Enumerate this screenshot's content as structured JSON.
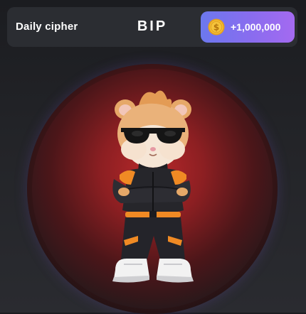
{
  "cipher": {
    "label": "Daily cipher",
    "word": "BIP",
    "reward": "+1,000,000"
  },
  "icons": {
    "coin": "coin-icon",
    "character": "hamster-character-icon"
  },
  "colors": {
    "bar_bg": "#2b2d32",
    "button_gradient_start": "#6c78ee",
    "button_gradient_end": "#a46af0",
    "coin_gold": "#f2b92e",
    "ring_red": "#e05050",
    "ring_blue": "#5d63c7"
  }
}
